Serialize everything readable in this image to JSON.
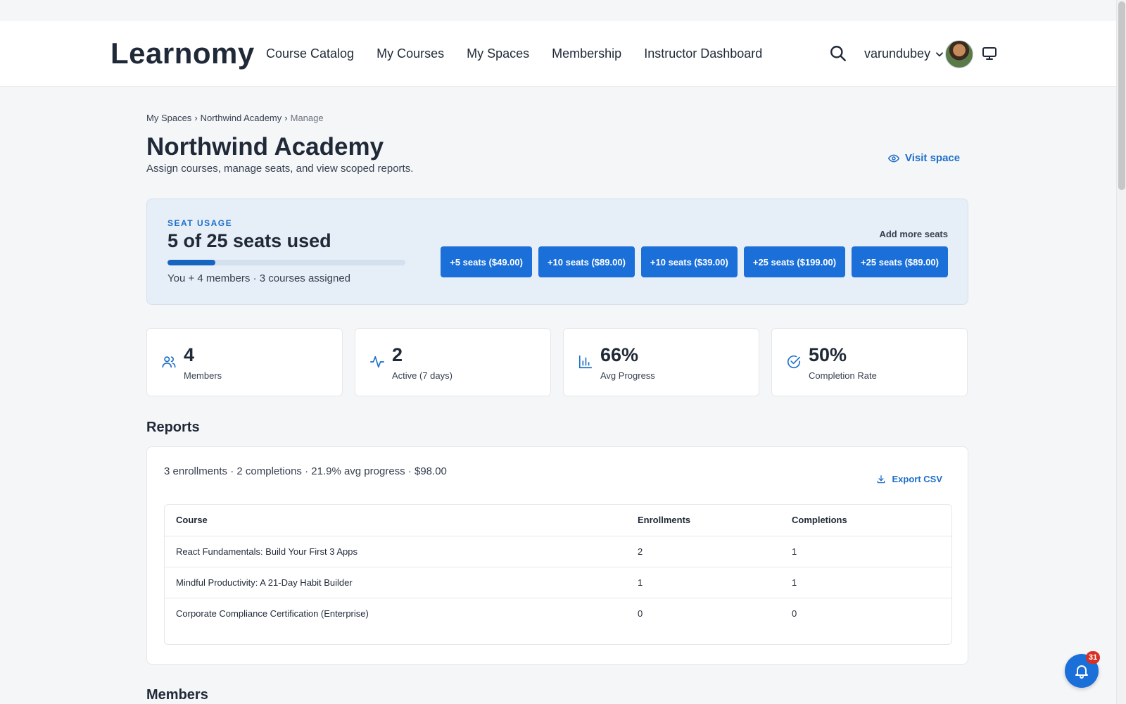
{
  "brand": {
    "name": "Learnomy"
  },
  "nav": {
    "links": [
      {
        "label": "Course Catalog"
      },
      {
        "label": "My Courses"
      },
      {
        "label": "My Spaces"
      },
      {
        "label": "Membership"
      },
      {
        "label": "Instructor Dashboard"
      }
    ],
    "icons": {
      "search": "search-icon",
      "monitor": "monitor-icon",
      "dropdown": "chevron-down-icon"
    },
    "username": "varundubey"
  },
  "breadcrumb": {
    "items": [
      "My Spaces",
      "Northwind Academy",
      "Manage"
    ],
    "separator": "›"
  },
  "page": {
    "title": "Northwind Academy",
    "subtitle": "Assign courses, manage seats, and view scoped reports.",
    "visit_label": "Visit space"
  },
  "seats": {
    "label": "SEAT USAGE",
    "headline": "5 of 25 seats used",
    "used": 5,
    "total": 25,
    "meta": "You + 4 members · 3 courses assigned",
    "add_more_label": "Add more seats",
    "buttons": [
      {
        "label": "+5 seats ($49.00)"
      },
      {
        "label": "+10 seats ($89.00)"
      },
      {
        "label": "+10 seats ($39.00)"
      },
      {
        "label": "+25 seats ($199.00)"
      },
      {
        "label": "+25 seats ($89.00)"
      }
    ]
  },
  "stats": [
    {
      "value": "4",
      "label": "Members",
      "icon": "users-icon"
    },
    {
      "value": "2",
      "label": "Active (7 days)",
      "icon": "activity-icon"
    },
    {
      "value": "66%",
      "label": "Avg Progress",
      "icon": "bar-chart-icon"
    },
    {
      "value": "50%",
      "label": "Completion Rate",
      "icon": "check-circle-icon"
    }
  ],
  "reports": {
    "title": "Reports",
    "summary": "3 enrollments · 2 completions · 21.9% avg progress · $98.00",
    "export_label": "Export CSV",
    "columns": [
      "Course",
      "Enrollments",
      "Completions"
    ],
    "rows": [
      [
        "React Fundamentals: Build Your First 3 Apps",
        "2",
        "1"
      ],
      [
        "Mindful Productivity: A 21-Day Habit Builder",
        "1",
        "1"
      ],
      [
        "Corporate Compliance Certification (Enterprise)",
        "0",
        "0"
      ]
    ]
  },
  "members": {
    "title": "Members"
  },
  "notifications": {
    "count": "31"
  },
  "colors": {
    "accent": "#1a6fd8",
    "link": "#1d6fc9",
    "badge": "#d93025",
    "seat_card_bg": "#e6eef7"
  }
}
